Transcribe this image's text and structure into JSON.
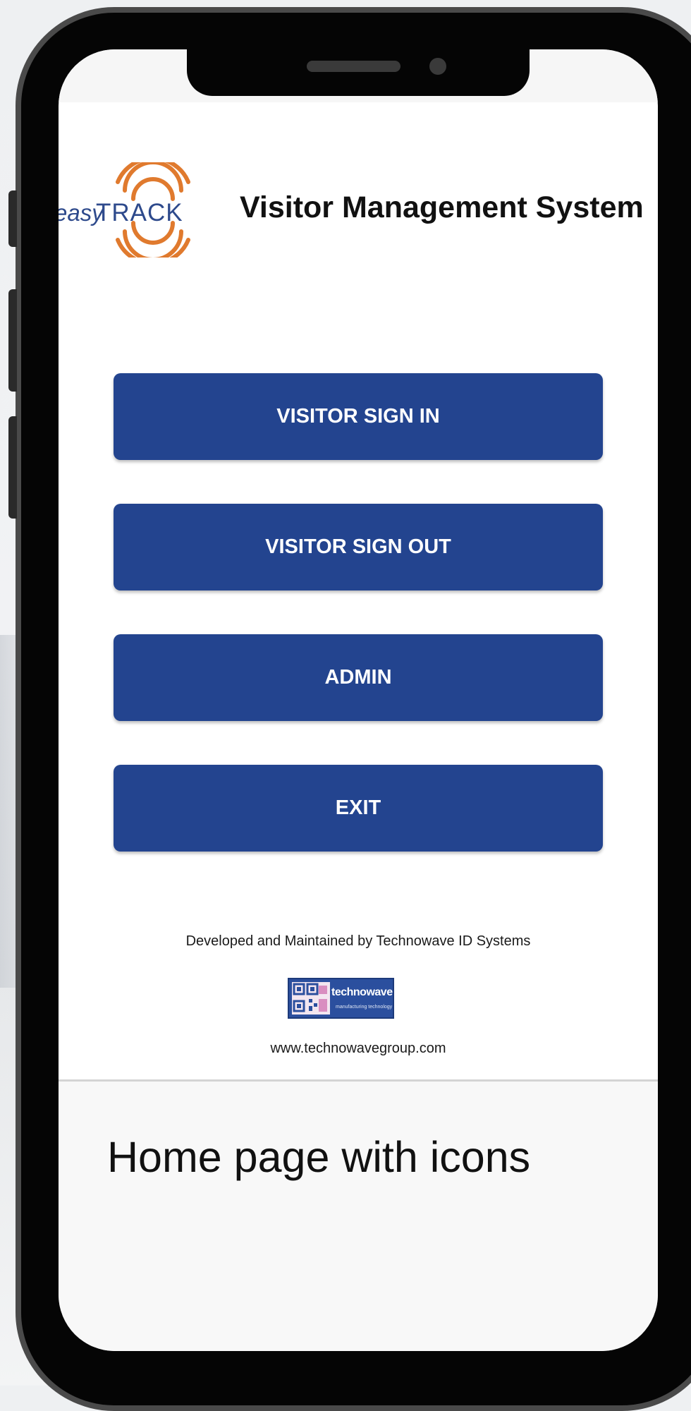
{
  "brand": {
    "logo_easy": "easy",
    "logo_track": "TRACK",
    "title": "Visitor Management System",
    "accent_color": "#23448f",
    "logo_color": "#e07a2e"
  },
  "menu": {
    "buttons": [
      {
        "label": "VISITOR SIGN IN"
      },
      {
        "label": "VISITOR SIGN OUT"
      },
      {
        "label": "ADMIN"
      },
      {
        "label": "EXIT"
      }
    ]
  },
  "footer": {
    "developed_by": "Developed and Maintained by Technowave ID Systems",
    "partner_logo_name": "technowave",
    "partner_logo_tagline": "manufacturing technology",
    "website": "www.technowavegroup.com"
  },
  "caption": "Home page with icons"
}
